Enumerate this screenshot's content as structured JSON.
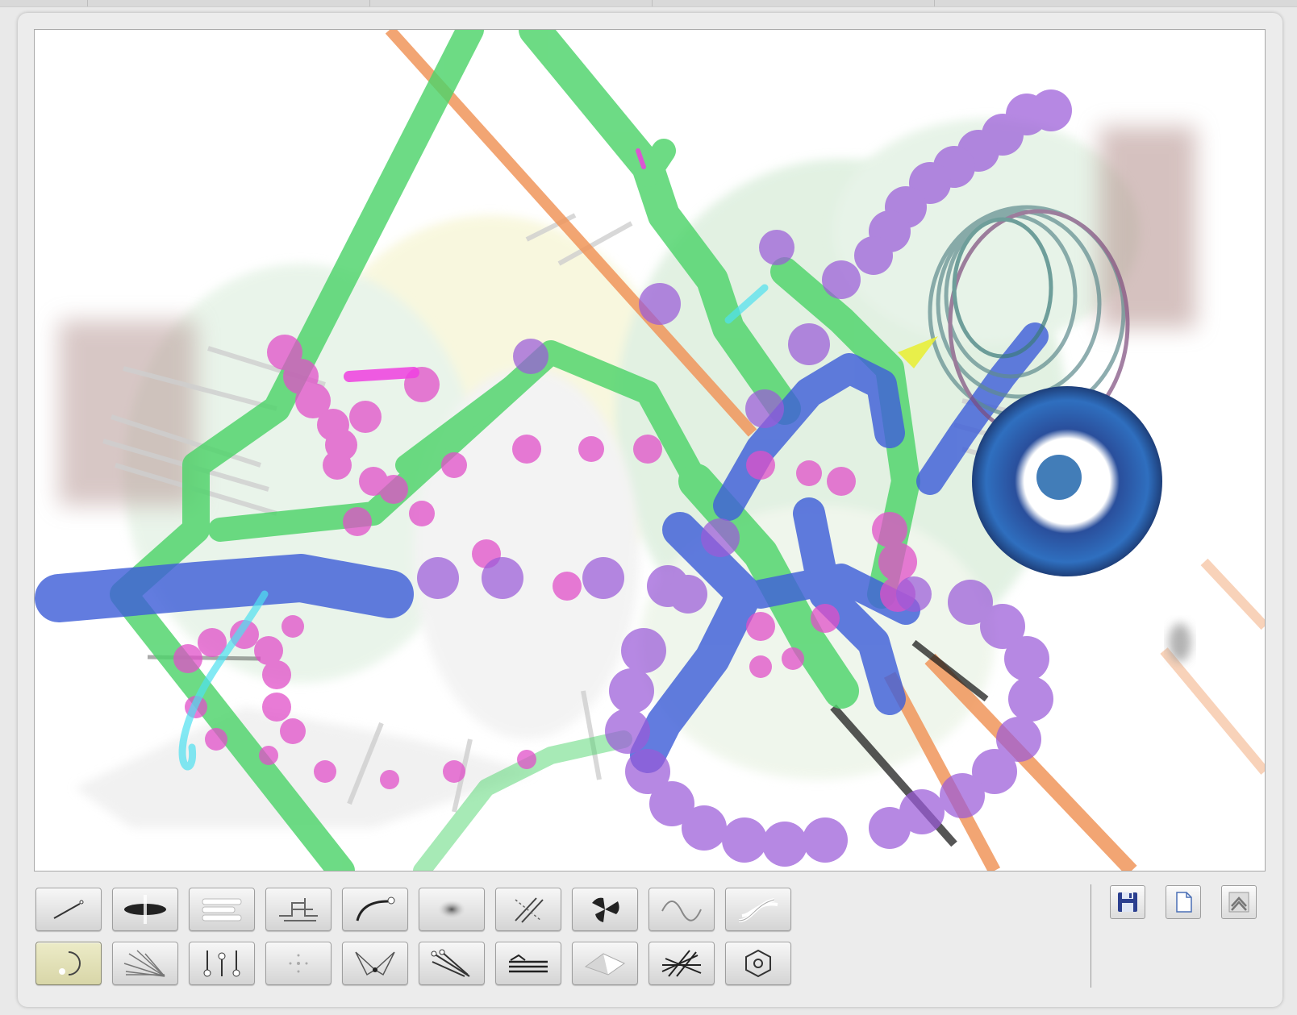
{
  "window": {
    "canvas": {
      "description_icon": "drawing-canvas"
    }
  },
  "toolbar": {
    "row1": [
      {
        "id": "line",
        "icon": "line-tool-icon"
      },
      {
        "id": "disc",
        "icon": "disc-tool-icon"
      },
      {
        "id": "bars",
        "icon": "bars-tool-icon"
      },
      {
        "id": "circuit",
        "icon": "circuit-tool-icon"
      },
      {
        "id": "arc",
        "icon": "arc-tool-icon"
      },
      {
        "id": "blur",
        "icon": "blur-tool-icon"
      },
      {
        "id": "hatch",
        "icon": "hatch-tool-icon"
      },
      {
        "id": "radiation",
        "icon": "radiation-tool-icon"
      },
      {
        "id": "wave",
        "icon": "wave-tool-icon"
      },
      {
        "id": "ribbon",
        "icon": "ribbon-tool-icon"
      }
    ],
    "row2": [
      {
        "id": "ring",
        "icon": "ring-tool-icon",
        "active": true
      },
      {
        "id": "fan",
        "icon": "fan-lines-tool-icon"
      },
      {
        "id": "pins",
        "icon": "pins-tool-icon"
      },
      {
        "id": "sparkle",
        "icon": "sparkle-tool-icon"
      },
      {
        "id": "web",
        "icon": "web-tool-icon"
      },
      {
        "id": "sticks",
        "icon": "sticks-tool-icon"
      },
      {
        "id": "strata",
        "icon": "strata-tool-icon"
      },
      {
        "id": "plane",
        "icon": "plane-tool-icon"
      },
      {
        "id": "scribble",
        "icon": "scribble-tool-icon"
      },
      {
        "id": "hexagon",
        "icon": "hexagon-tool-icon"
      }
    ]
  },
  "file_actions": [
    {
      "id": "save",
      "icon": "save-icon"
    },
    {
      "id": "new",
      "icon": "new-document-icon"
    },
    {
      "id": "upload",
      "icon": "upload-icon"
    }
  ],
  "colors": {
    "accent_green": "#4dd36a",
    "accent_blue": "#3f5fd8",
    "accent_pink": "#e04fc8",
    "accent_violet": "#9a5ad8",
    "accent_orange": "#f0955a",
    "active_tool": "#e3e1b6"
  }
}
